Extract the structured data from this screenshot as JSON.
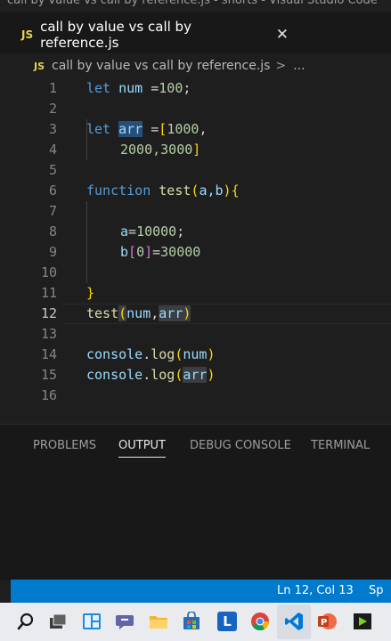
{
  "window": {
    "title": "call by value vs call by reference.js - shorts - Visual Studio Code"
  },
  "tab": {
    "badge": "JS",
    "label": "call by value vs call by reference.js",
    "close": "✕"
  },
  "breadcrumb": {
    "badge": "JS",
    "file": "call by value vs call by reference.js",
    "separator": ">",
    "more": "..."
  },
  "editor": {
    "line_numbers": [
      "1",
      "2",
      "3",
      "4",
      "5",
      "6",
      "7",
      "8",
      "9",
      "10",
      "11",
      "12",
      "13",
      "14",
      "15",
      "16"
    ],
    "active_line": 12,
    "code": {
      "l1_kw": "let",
      "l1_var": "num",
      "l1_op": " =",
      "l1_num": "100",
      "l1_end": ";",
      "l3_kw": "let",
      "l3_var": "arr",
      "l3_op": " =",
      "l3_open": "[",
      "l3_num": "1000",
      "l3_end": ",",
      "l4_nums": "2000,3000",
      "l4_close": "]",
      "l6_kw": "function",
      "l6_fn": "test",
      "l6_open": "(",
      "l6_params": "a,b",
      "l6_close": ")",
      "l6_brace": "{",
      "l8_var": "a",
      "l8_op": "=",
      "l8_num": "10000",
      "l8_end": ";",
      "l9_var": "b",
      "l9_open": "[",
      "l9_idx": "0",
      "l9_close": "]",
      "l9_op": "=",
      "l9_num": "30000",
      "l11_brace": "}",
      "l12_fn": "test",
      "l12_open": "(",
      "l12_a1": "num",
      "l12_comma": ",",
      "l12_a2": "arr",
      "l12_close": ")",
      "l14_obj": "console",
      "l14_dot": ".",
      "l14_fn": "log",
      "l14_open": "(",
      "l14_arg": "num",
      "l14_close": ")",
      "l15_obj": "console",
      "l15_dot": ".",
      "l15_fn": "log",
      "l15_open": "(",
      "l15_arg": "arr",
      "l15_close": ")"
    }
  },
  "panel": {
    "tabs": [
      "PROBLEMS",
      "OUTPUT",
      "DEBUG CONSOLE",
      "TERMINAL"
    ],
    "active_tab": "OUTPUT"
  },
  "statusbar": {
    "position": "Ln 12, Col 13",
    "spaces": "Sp"
  },
  "taskbar": {
    "icons": [
      "search-icon",
      "task-view-icon",
      "widgets-icon",
      "teams-chat-icon",
      "file-explorer-icon",
      "store-icon",
      "app-l-icon",
      "chrome-icon",
      "vscode-icon",
      "powerpoint-icon",
      "media-app-icon"
    ],
    "app_l_letter": "L"
  },
  "colors": {
    "accent": "#007acc",
    "keyword": "#569cd6",
    "variable": "#9cdcfe",
    "function": "#dcdcaa",
    "number": "#b5cea8",
    "js_badge": "#e8d44d"
  }
}
